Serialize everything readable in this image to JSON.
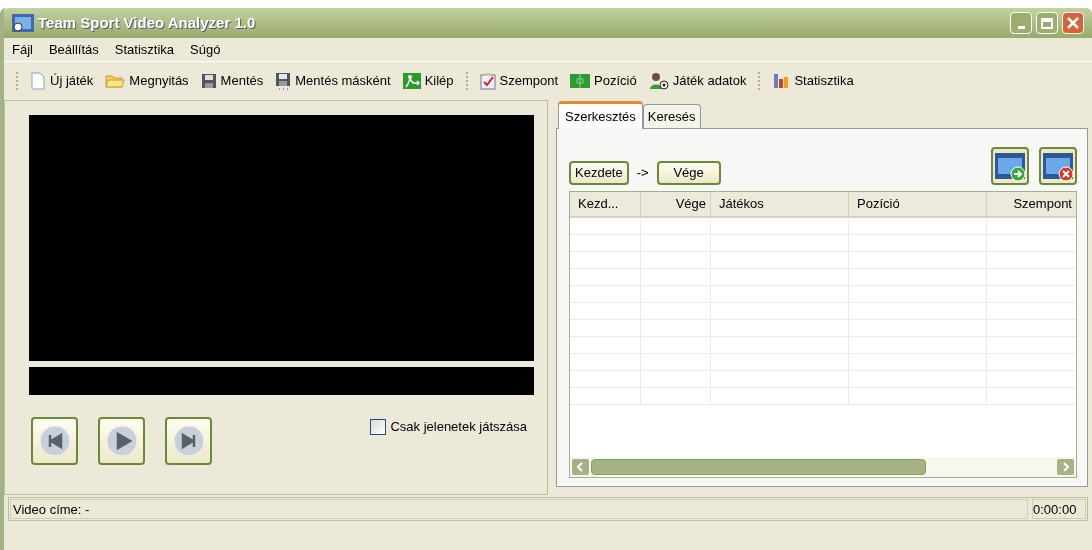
{
  "window": {
    "title": "Team Sport Video Analyzer 1.0"
  },
  "menu": [
    "Fájl",
    "Beállítás",
    "Statisztika",
    "Súgó"
  ],
  "toolbar": [
    [
      {
        "kind": "new",
        "label": "Új játék"
      },
      {
        "kind": "open",
        "label": "Megnyitás"
      },
      {
        "kind": "save",
        "label": "Mentés"
      },
      {
        "kind": "saveas",
        "label": "Mentés másként"
      },
      {
        "kind": "exit",
        "label": "Kilép"
      }
    ],
    [
      {
        "kind": "aspect",
        "label": "Szempont"
      },
      {
        "kind": "field",
        "label": "Pozíció"
      },
      {
        "kind": "player",
        "label": "Játék adatok"
      }
    ],
    [
      {
        "kind": "chart",
        "label": "Statisztika"
      }
    ]
  ],
  "player": {
    "buttons": [
      {
        "kind": "prev"
      },
      {
        "kind": "play"
      },
      {
        "kind": "next"
      }
    ],
    "checkbox": {
      "label": "Csak jelenetek játszása",
      "checked": false
    }
  },
  "tabs": [
    {
      "label": "Szerkesztés",
      "selected": true
    },
    {
      "label": "Keresés",
      "selected": false
    }
  ],
  "range": {
    "start": "Kezdete",
    "arrow": "->",
    "end": "Vége"
  },
  "table": {
    "columns": [
      "Kezd...",
      "Vége",
      "Játékos",
      "Pozíció",
      "Szempont"
    ]
  },
  "status_bar": {
    "text": "Video címe: -",
    "time": "0:00:00"
  }
}
